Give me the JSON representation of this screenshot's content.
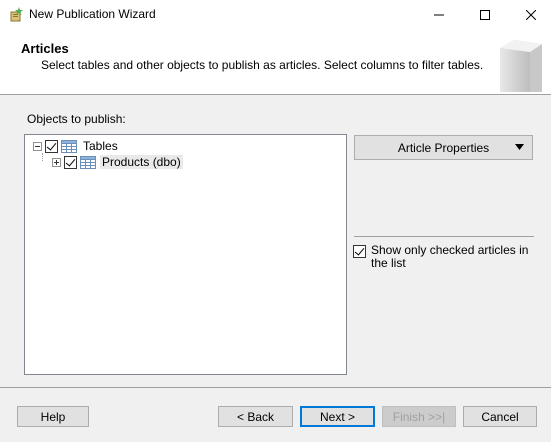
{
  "window": {
    "title": "New Publication Wizard",
    "icons": {
      "app": "wizard-app-icon",
      "minimize": "minimize-icon",
      "maximize": "maximize-icon",
      "close": "close-icon"
    }
  },
  "header": {
    "title": "Articles",
    "subtitle": "Select tables and other objects to publish as articles. Select columns to filter tables."
  },
  "objects": {
    "label": "Objects to publish:",
    "tree": [
      {
        "label": "Tables",
        "checked": true,
        "expanded": true,
        "icon": "table-icon"
      },
      {
        "label": "Products (dbo)",
        "checked": true,
        "expanded": false,
        "icon": "table-icon"
      }
    ]
  },
  "article_properties": {
    "label": "Article Properties",
    "icon": "dropdown-arrow-icon"
  },
  "show_only_checked": {
    "label": "Show only checked articles in the list",
    "checked": true
  },
  "buttons": {
    "help": "Help",
    "back": "< Back",
    "next": "Next >",
    "finish": "Finish >>|",
    "cancel": "Cancel"
  },
  "colors": {
    "accent": "#0078d7",
    "dialog_bg": "#f0f0f0",
    "button_bg": "#e1e1e1",
    "disabled_text": "#a0a0a0"
  }
}
